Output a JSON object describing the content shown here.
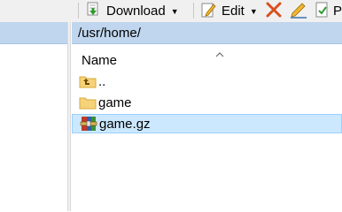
{
  "toolbar": {
    "download_label": "Download",
    "edit_label": "Edit",
    "partial_label": "P"
  },
  "remote": {
    "path": "/usr/home/",
    "column_name": "Name",
    "files": [
      {
        "name": "..",
        "icon": "parent-folder-icon"
      },
      {
        "name": "game",
        "icon": "folder-icon"
      },
      {
        "name": "game.gz",
        "icon": "archive-icon",
        "selected": true
      }
    ]
  },
  "colors": {
    "path_bar": "#bfd6ee",
    "selection": "#cce8ff",
    "delete_icon": "#d9501e"
  }
}
